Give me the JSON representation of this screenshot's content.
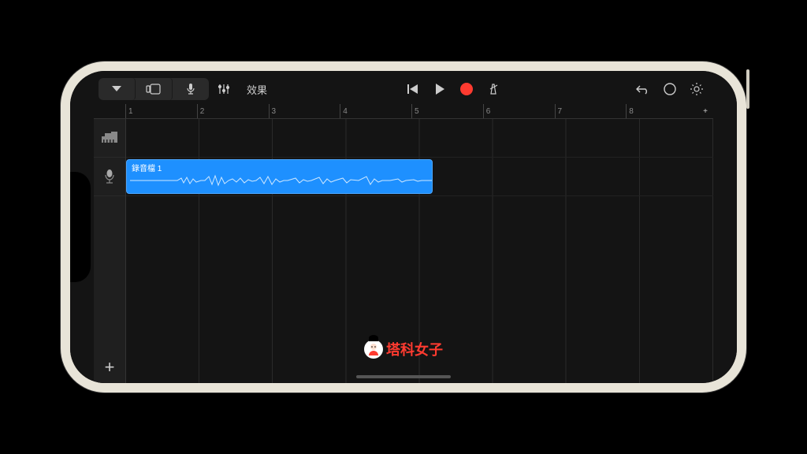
{
  "toolbar": {
    "fx_label": "效果"
  },
  "ruler": {
    "marks": [
      "1",
      "2",
      "3",
      "4",
      "5",
      "6",
      "7",
      "8"
    ],
    "add": "+"
  },
  "tracks": {
    "piano": {
      "icon": "piano-icon"
    },
    "audio": {
      "icon": "microphone-icon",
      "clip_label": "錄音檔 1"
    },
    "add": "+"
  },
  "watermark": {
    "text": "塔科女子"
  }
}
